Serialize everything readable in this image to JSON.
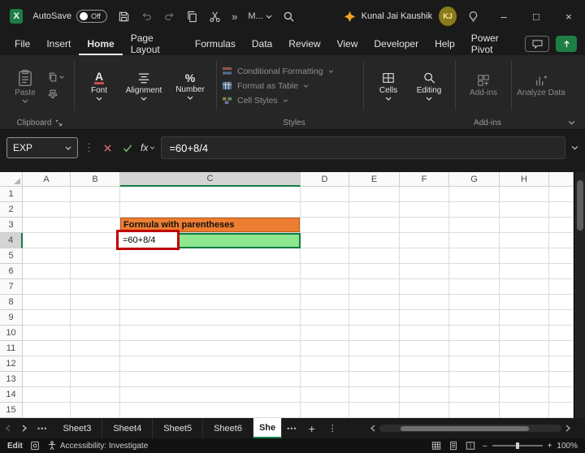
{
  "titlebar": {
    "app_letter": "X",
    "autosave_label": "AutoSave",
    "autosave_state": "Off",
    "overflow_glyph": "»",
    "more_label": "M...",
    "user_name": "Kunal Jai Kaushik",
    "user_initials": "KJ",
    "minimize_glyph": "–",
    "maximize_glyph": "□",
    "close_glyph": "×"
  },
  "menu": {
    "items": [
      "File",
      "Insert",
      "Home",
      "Page Layout",
      "Formulas",
      "Data",
      "Review",
      "View",
      "Developer",
      "Help",
      "Power Pivot"
    ],
    "active": "Home"
  },
  "ribbon": {
    "paste_label": "Paste",
    "font_label": "Font",
    "alignment_label": "Alignment",
    "number_label": "Number",
    "styles_items": [
      "Conditional Formatting",
      "Format as Table",
      "Cell Styles"
    ],
    "cells_label": "Cells",
    "editing_label": "Editing",
    "addins_label": "Add-ins",
    "analyze_label": "Analyze Data",
    "clipboard_group_label": "Clipboard",
    "styles_group_label": "Styles",
    "addins_group_label": "Add-ins",
    "font_icon_glyph": "A",
    "number_icon_glyph": "%"
  },
  "formula_bar": {
    "name_box": "EXP",
    "fx_label": "fx",
    "formula": "=60+8/4"
  },
  "grid": {
    "columns": [
      "A",
      "B",
      "C",
      "D",
      "E",
      "F",
      "G",
      "H"
    ],
    "row_count": 15,
    "selected_column": "C",
    "selected_row": 4,
    "cells": {
      "C3": {
        "text": "Formula with parentheses",
        "fill": "#ED7D31"
      },
      "C4": {
        "text": "=60+8/4",
        "fill": "#8FE78F"
      }
    },
    "colors": {
      "selection_border": "#107C41",
      "annotation_border": "#C00000",
      "header_selected": "#D4D4D4",
      "orange_border": "#B85C1E"
    }
  },
  "sheet_bar": {
    "tabs": [
      "Sheet3",
      "Sheet4",
      "Sheet5",
      "Sheet6"
    ],
    "active_tab": "She",
    "ellipsis_glyph": "•••",
    "add_glyph": "+",
    "menu_glyph": "⋮"
  },
  "status_bar": {
    "mode": "Edit",
    "accessibility_text": "Accessibility: Investigate",
    "zoom_out_glyph": "–",
    "zoom_in_glyph": "+",
    "zoom_value": "100%"
  }
}
